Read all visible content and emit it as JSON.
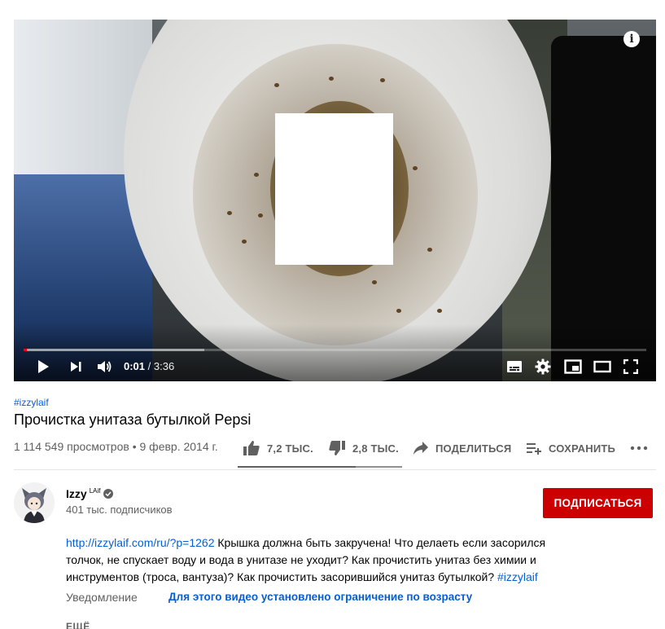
{
  "player": {
    "time_current": "0:01",
    "time_separator": " / ",
    "time_total": "3:36",
    "progress_played_fraction": 0.005,
    "progress_buffered_fraction": 0.29,
    "info_label": "i"
  },
  "video": {
    "hashtag": "#izzylaif",
    "title": "Прочистка унитаза бутылкой Pepsi",
    "views": "1 114 549 просмотров",
    "date_separator": " • ",
    "date": "9 февр. 2014 г."
  },
  "actions": {
    "like_count": "7,2 ТЫС.",
    "dislike_count": "2,8 ТЫС.",
    "share_label": "ПОДЕЛИТЬСЯ",
    "save_label": "СОХРАНИТЬ",
    "like_fraction": 0.72
  },
  "channel": {
    "name": "Izzy",
    "name_suffix": "LAif",
    "subscribers": "401 тыс. подписчиков",
    "subscribe_label": "ПОДПИСАТЬСЯ"
  },
  "description": {
    "link": "http://izzylaif.com/ru/?p=1262",
    "text": " Крышка должна быть закручена! Что делаеть если засорился толчок, не спускает воду и вода в унитазе не уходит? Как прочистить унитаз без химии и инструментов (троса, вантуза)? Как прочистить засорившийся унитаз бутылкой? ",
    "hashtag": "#izzylaif",
    "notice_label": "Уведомление",
    "notice_value": "Для этого видео установлено ограничение по возрасту",
    "more_label": "ЕЩЁ"
  },
  "colors": {
    "accent_red": "#cc0000",
    "progress_red": "#ff0000",
    "link_blue": "#065fd4",
    "text_secondary": "#606060"
  }
}
